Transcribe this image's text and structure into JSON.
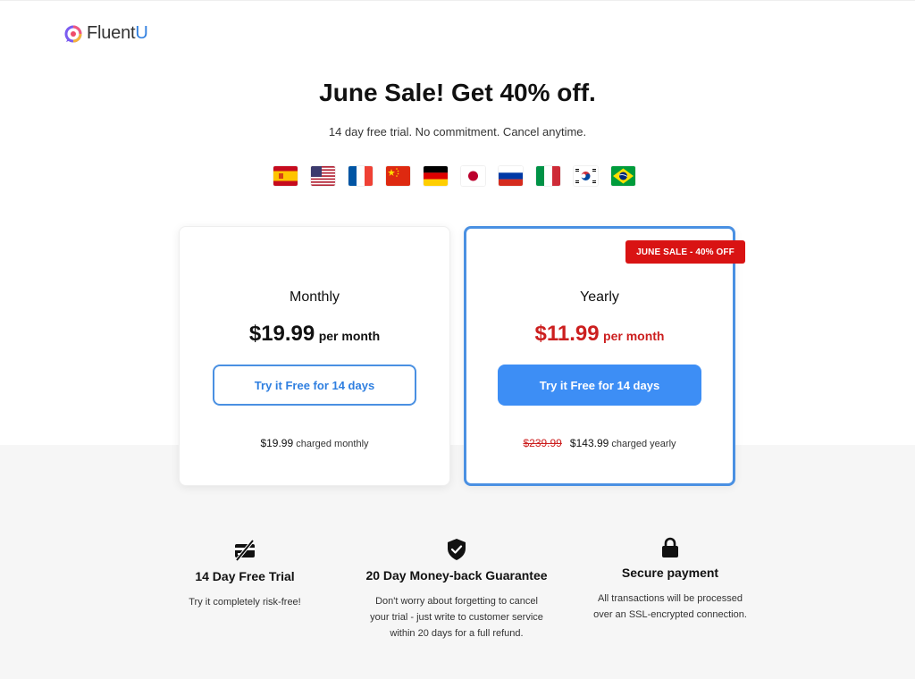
{
  "brand": {
    "logo_text_main": "Fluent",
    "logo_text_accent": "U"
  },
  "headline": "June Sale! Get 40% off.",
  "subheadline": "14 day free trial. No commitment. Cancel anytime.",
  "flags": [
    "spain-flag",
    "usa-flag",
    "france-flag",
    "china-flag",
    "germany-flag",
    "japan-flag",
    "russia-flag",
    "italy-flag",
    "korea-flag",
    "brazil-flag"
  ],
  "plans": {
    "monthly": {
      "name": "Monthly",
      "price": "$19.99",
      "per": "per month",
      "cta": "Try it Free for 14 days",
      "charge_amount": "$19.99",
      "charge_text": "charged monthly"
    },
    "yearly": {
      "badge": "JUNE SALE - 40% OFF",
      "name": "Yearly",
      "price": "$11.99",
      "per": "per month",
      "cta": "Try it Free for 14 days",
      "original_amount": "$239.99",
      "charge_amount": "$143.99",
      "charge_text": "charged yearly"
    }
  },
  "features": [
    {
      "icon": "no-card-icon",
      "title": "14 Day Free Trial",
      "desc": "Try it completely risk-free!"
    },
    {
      "icon": "shield-check-icon",
      "title": "20 Day Money-back Guarantee",
      "desc_lines": [
        "Don't worry about forgetting to cancel",
        "your trial - just write to customer service",
        "within 20 days for a full refund."
      ]
    },
    {
      "icon": "lock-icon",
      "title": "Secure payment",
      "desc_lines": [
        "All transactions will be processed",
        "over an SSL-encrypted connection."
      ]
    }
  ],
  "colors": {
    "accent_blue": "#3d8ef5",
    "sale_red": "#d91313",
    "price_red": "#cc1f1f"
  }
}
